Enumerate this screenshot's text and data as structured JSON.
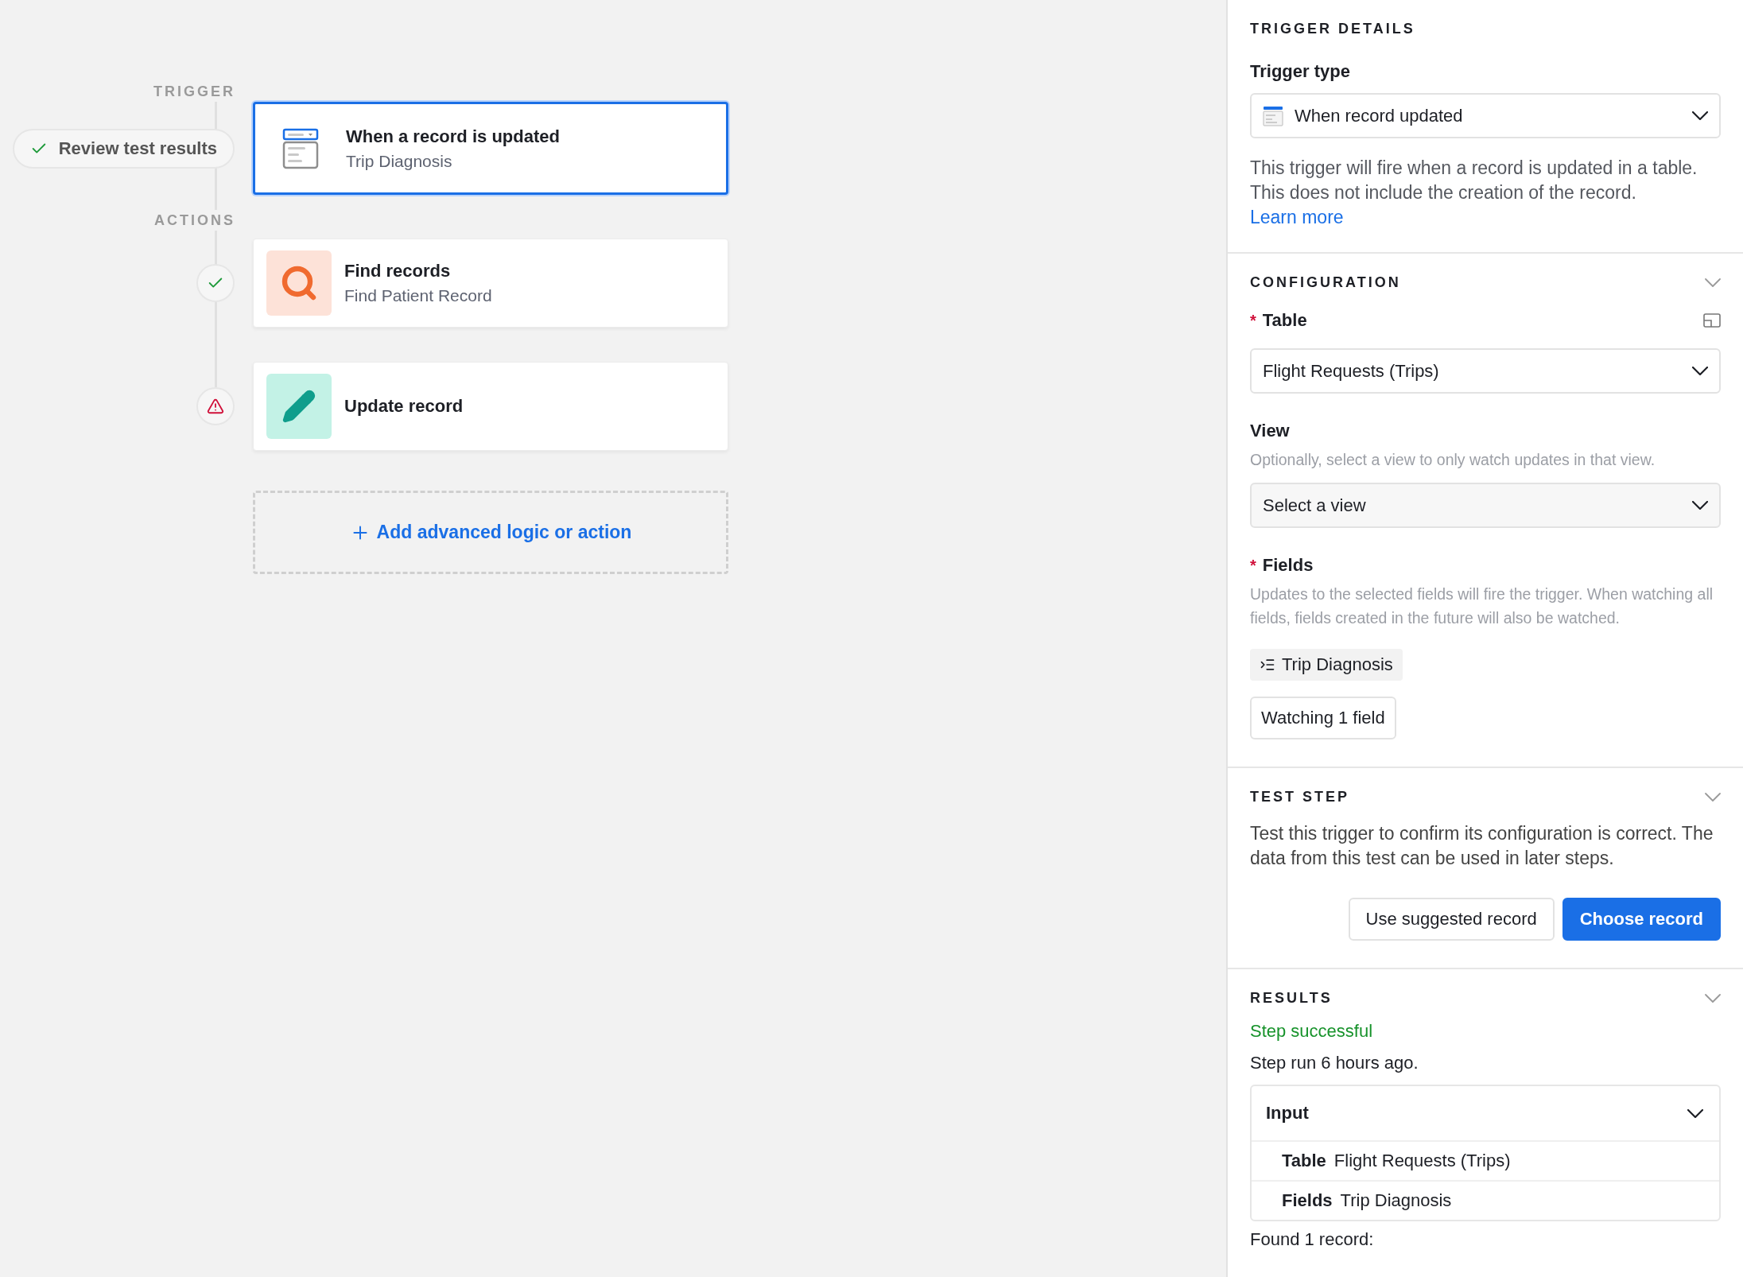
{
  "canvas": {
    "trigger_label": "TRIGGER",
    "review_button": {
      "label": "Review test results",
      "checked": true
    },
    "actions_label": "ACTIONS",
    "steps": [
      {
        "kind": "trigger",
        "title": "When a record is updated",
        "subtitle": "Trip Diagnosis",
        "selected": true
      },
      {
        "kind": "find",
        "title": "Find records",
        "subtitle": "Find Patient Record",
        "selected": false,
        "error": false
      },
      {
        "kind": "update",
        "title": "Update record",
        "selected": false,
        "error": true
      }
    ],
    "add_button": "Add advanced logic or action"
  },
  "panel": {
    "trigger_details": {
      "heading": "TRIGGER DETAILS",
      "trigger_type": {
        "label": "Trigger type",
        "value": "When record updated"
      },
      "description": "This trigger will fire when a record is updated in a table. This does not include the creation of the record.",
      "link": "Learn more"
    },
    "configuration": {
      "heading": "CONFIGURATION",
      "table": {
        "marker": "*",
        "label": "Table",
        "value": "Flight Requests (Trips)"
      },
      "view": {
        "label": "View",
        "hint": "Optionally, select a view to only watch updates in that view.",
        "placeholder": "Select a view"
      },
      "fields": {
        "marker": "*",
        "label": "Fields",
        "hint": "Updates to the selected fields will fire the trigger. When watching all fields, fields created in the future will also be watched.",
        "chips": [
          "Trip Diagnosis"
        ],
        "watch_button": "Watching 1 field"
      }
    },
    "test_step": {
      "heading": "TEST STEP",
      "description": "Test this trigger to confirm its configuration is correct. The data from this test can be used in later steps.",
      "buttons": [
        {
          "label": "Use suggested record",
          "primary": false
        },
        {
          "label": "Choose record",
          "primary": true
        }
      ]
    },
    "results": {
      "heading": "RESULTS",
      "status": "Step successful",
      "run_info": "Step run 6 hours ago.",
      "input": {
        "title": "Input",
        "rows": [
          {
            "label": "Table",
            "value": "Flight Requests (Trips)"
          },
          {
            "label": "Fields",
            "value": "Trip Diagnosis"
          }
        ]
      },
      "found": "Found 1 record:"
    }
  }
}
